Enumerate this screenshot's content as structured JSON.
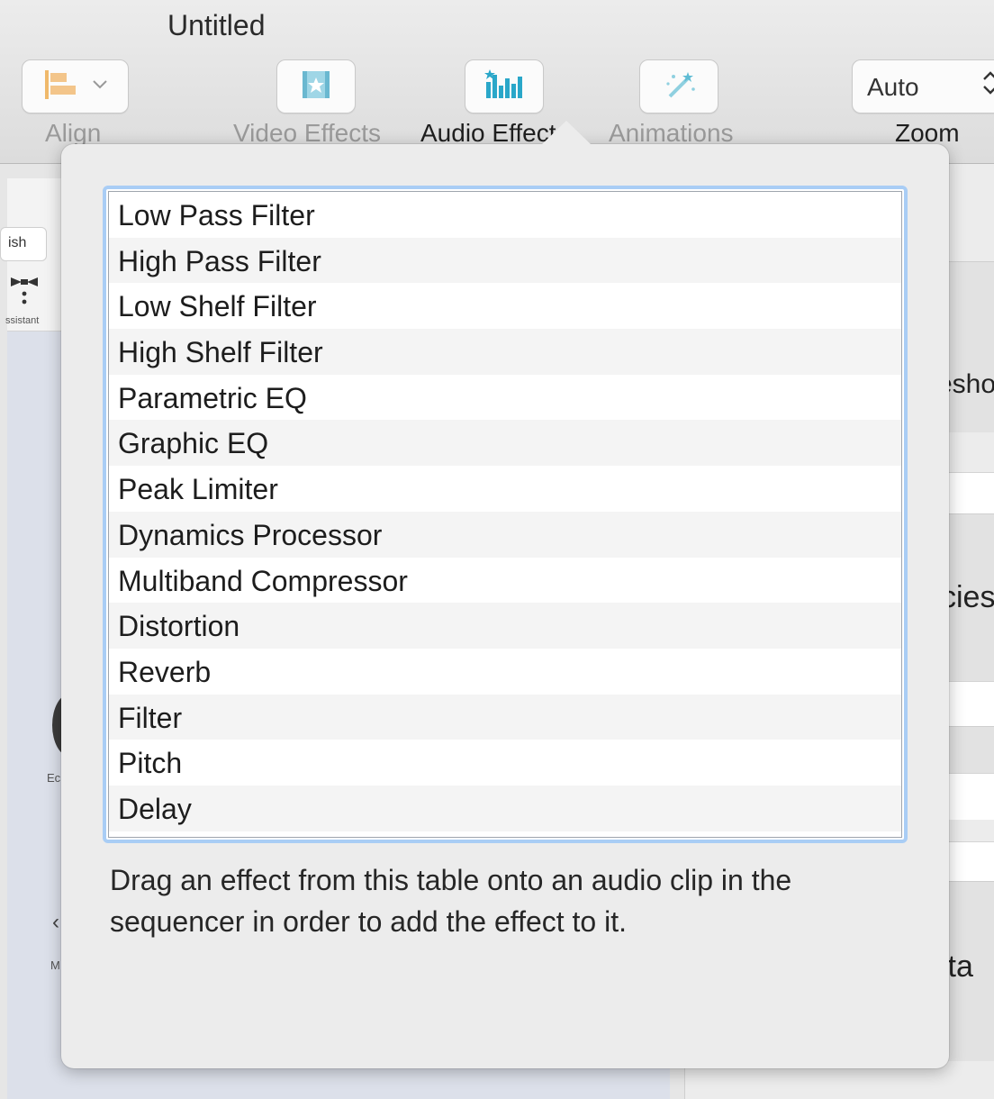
{
  "window": {
    "title": "Untitled"
  },
  "toolbar": {
    "align_label": "Align",
    "video_effects_label": "Video Effects",
    "audio_effects_label": "Audio Effects",
    "animations_label": "Animations",
    "zoom_label": "Zoom",
    "zoom_value": "Auto",
    "icons": [
      "align-icon",
      "chevron-down-icon",
      "video-effects-icon",
      "audio-effects-icon",
      "animations-wand-icon",
      "stepper-arrows-icon"
    ]
  },
  "background": {
    "finish_label": "ish",
    "assistant_label": "ssistant",
    "left_e": "Ec",
    "left_m": "M",
    "right_text_1": "esho",
    "right_text_2": "cies",
    "right_text_3": "lta"
  },
  "popover": {
    "effects": [
      "Low Pass Filter",
      "High Pass Filter",
      "Low Shelf Filter",
      "High Shelf Filter",
      "Parametric EQ",
      "Graphic EQ",
      "Peak Limiter",
      "Dynamics Processor",
      "Multiband Compressor",
      "Distortion",
      "Reverb",
      "Filter",
      "Pitch",
      "Delay"
    ],
    "hint": "Drag an effect from this table onto an audio clip in the sequencer in order to add the effect to it."
  },
  "colors": {
    "focus_ring": "#a9cdf5",
    "popover_bg": "#ececec",
    "toolbar_icon_accent": "#f0b96b",
    "audio_icon_accent": "#2aa7c9"
  }
}
